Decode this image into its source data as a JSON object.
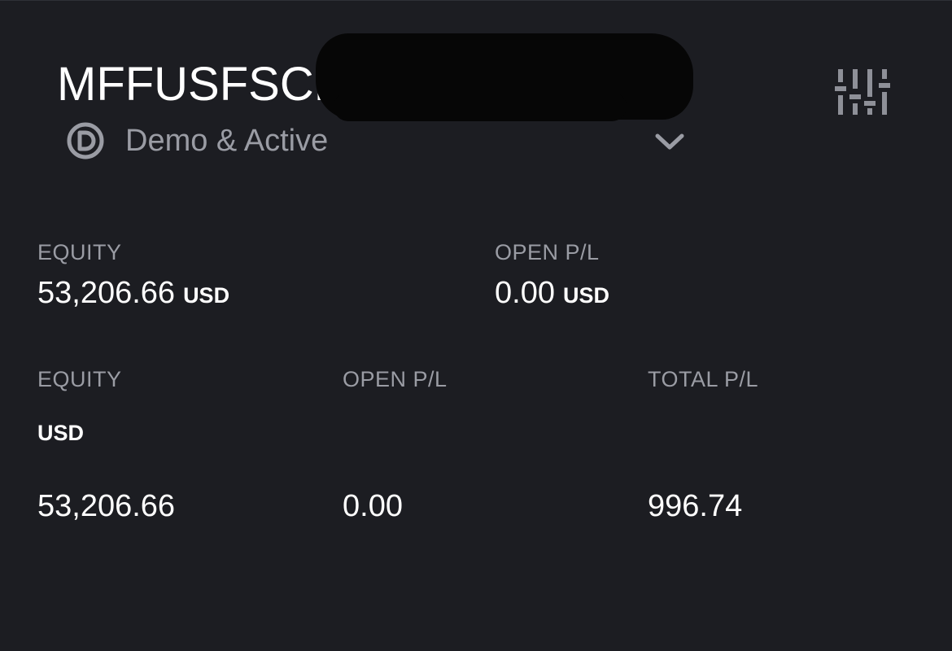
{
  "account": {
    "name": "MFFUSFSCL",
    "status": "Demo & Active"
  },
  "icons": {
    "status": "demo-badge-icon",
    "dropdown": "chevron-down-icon",
    "settings": "sliders-icon"
  },
  "summary": {
    "equity_label": "EQUITY",
    "equity_value": "53,206.66",
    "equity_unit": "USD",
    "open_pl_label": "OPEN P/L",
    "open_pl_value": "0.00",
    "open_pl_unit": "USD"
  },
  "table": {
    "headers": [
      "EQUITY",
      "OPEN P/L",
      "TOTAL P/L"
    ],
    "currency": "USD",
    "rows": [
      [
        "53,206.66",
        "0.00",
        "996.74"
      ]
    ]
  },
  "colors": {
    "background": "#1c1d22",
    "primary_text": "#ffffff",
    "muted_text": "#9a9ca4"
  }
}
